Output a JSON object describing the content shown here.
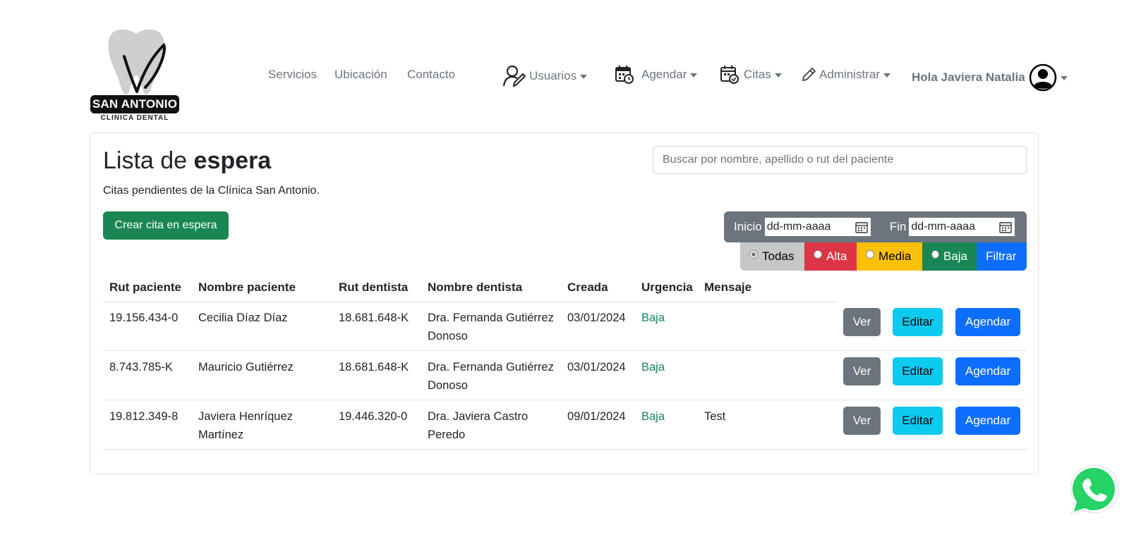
{
  "logo": {
    "name": "SAN ANTONIO",
    "subtitle": "CLINICA DENTAL"
  },
  "nav": {
    "links": [
      "Servicios",
      "Ubicación",
      "Contacto"
    ],
    "usuarios": "Usuarios",
    "agendar": "Agendar",
    "citas": "Citas",
    "administrar": "Administrar",
    "greeting": "Hola Javiera Natalia"
  },
  "page": {
    "title_light": "Lista de ",
    "title_bold": "espera",
    "subtitle": "Citas pendientes de la Clínica San Antonio.",
    "search_placeholder": "Buscar por nombre, apellido o rut del paciente",
    "create_button": "Crear cita en espera"
  },
  "date_filter": {
    "start_label": "Inicio",
    "start_value": "dd-mm-aaaa",
    "end_label": "Fin",
    "end_value": "dd-mm-aaaa"
  },
  "urgency_filter": {
    "options": [
      {
        "label": "Todas",
        "color": "#c6c7c8",
        "text_color": "#000000",
        "selected": true
      },
      {
        "label": "Alta",
        "color": "#dc3545",
        "text_color": "#ffffff",
        "selected": false
      },
      {
        "label": "Media",
        "color": "#ffc107",
        "text_color": "#000000",
        "selected": false
      },
      {
        "label": "Baja",
        "color": "#198754",
        "text_color": "#ffffff",
        "selected": false
      }
    ],
    "apply_label": "Filtrar",
    "apply_color": "#0d6efd"
  },
  "table": {
    "headers": [
      "Rut paciente",
      "Nombre paciente",
      "Rut dentista",
      "Nombre dentista",
      "Creada",
      "Urgencia",
      "Mensaje"
    ],
    "rows": [
      {
        "rut_paciente": "19.156.434-0",
        "nombre_l1": "Cecilia Díaz Díaz",
        "nombre_l2": "",
        "rut_dentista": "18.681.648-K",
        "dentista_l1": "Dra. Fernanda Gutiérrez",
        "dentista_l2": "Donoso",
        "creada": "03/01/2024",
        "urgencia": "Baja",
        "mensaje": ""
      },
      {
        "rut_paciente": "8.743.785-K",
        "nombre_l1": "Mauricio Gutiérrez",
        "nombre_l2": "",
        "rut_dentista": "18.681.648-K",
        "dentista_l1": "Dra. Fernanda Gutiérrez",
        "dentista_l2": "Donoso",
        "creada": "03/01/2024",
        "urgencia": "Baja",
        "mensaje": ""
      },
      {
        "rut_paciente": "19.812.349-8",
        "nombre_l1": "Javiera Henríquez",
        "nombre_l2": "Martínez",
        "rut_dentista": "19.446.320-0",
        "dentista_l1": "Dra. Javiera Castro",
        "dentista_l2": "Peredo",
        "creada": "09/01/2024",
        "urgencia": "Baja",
        "mensaje": "Test"
      }
    ],
    "actions": {
      "view": "Ver",
      "edit": "Editar",
      "schedule": "Agendar"
    }
  },
  "colors": {
    "accent": "#0d6efd",
    "success": "#198754",
    "info": "#0dcaf0",
    "secondary": "#6c757d",
    "whatsapp": "#25d366"
  }
}
